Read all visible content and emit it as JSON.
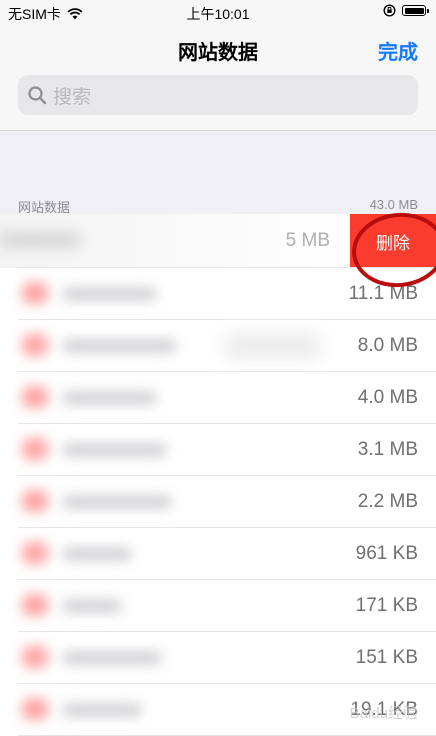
{
  "status_bar": {
    "carrier": "无SIM卡",
    "time": "上午10:01"
  },
  "nav": {
    "title": "网站数据",
    "done_label": "完成"
  },
  "search": {
    "placeholder": "搜索"
  },
  "section": {
    "label": "网站数据",
    "total": "43.0 MB"
  },
  "swiped_row": {
    "size": "5 MB",
    "delete_label": "删除"
  },
  "rows": [
    {
      "size": "11.1 MB"
    },
    {
      "size": "8.0 MB"
    },
    {
      "size": "4.0 MB"
    },
    {
      "size": "3.1 MB"
    },
    {
      "size": "2.2 MB"
    },
    {
      "size": "961 KB"
    },
    {
      "size": "171 KB"
    },
    {
      "size": "151 KB"
    },
    {
      "size": "19.1 KB"
    }
  ],
  "watermark": "Baidu经验",
  "colors": {
    "accent": "#1479fb",
    "delete": "#fa3c2f",
    "annotation": "#b90c0c"
  }
}
